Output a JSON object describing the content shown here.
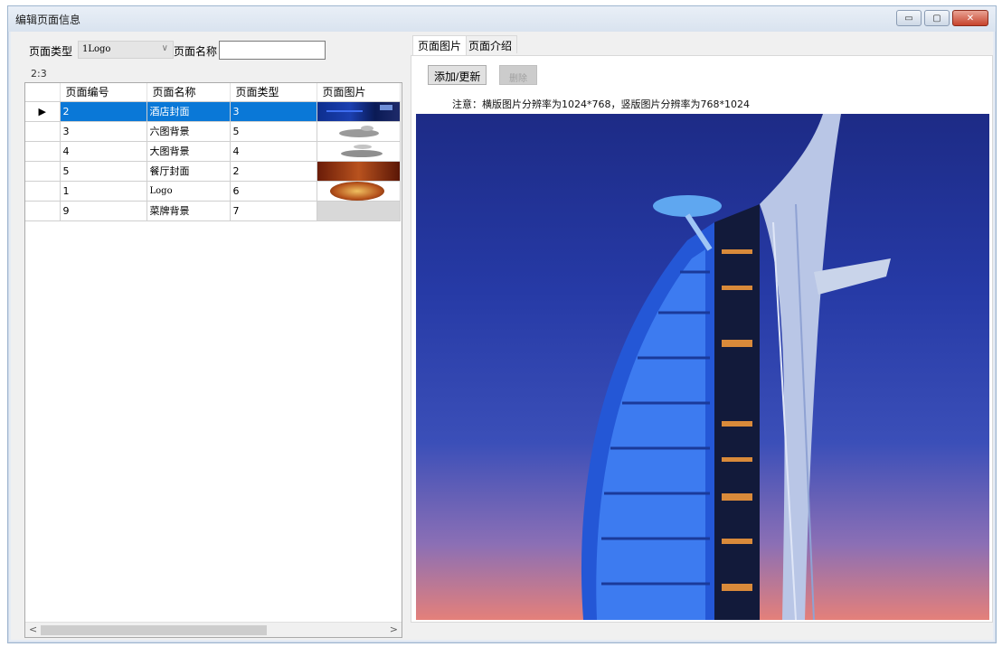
{
  "window": {
    "title": "编辑页面信息",
    "buttons": {
      "minimize": "▭",
      "maximize": "▢",
      "close": "✕"
    }
  },
  "filter": {
    "type_label": "页面类型",
    "type_value": "1Logo",
    "name_label": "页面名称",
    "name_value": ""
  },
  "ratio": "2:3",
  "grid": {
    "columns": [
      "页面编号",
      "页面名称",
      "页面类型",
      "页面图片"
    ],
    "rows": [
      {
        "id": "2",
        "name": "酒店封面",
        "type": "3",
        "thumb": "blue-night",
        "selected": true
      },
      {
        "id": "3",
        "name": "六图背景",
        "type": "5",
        "thumb": "gray-splash",
        "selected": false
      },
      {
        "id": "4",
        "name": "大图背景",
        "type": "4",
        "thumb": "gray-splash",
        "selected": false
      },
      {
        "id": "5",
        "name": "餐厅封面",
        "type": "2",
        "thumb": "restaurant",
        "selected": false
      },
      {
        "id": "1",
        "name": "Logo",
        "type": "6",
        "thumb": "logo",
        "selected": false
      },
      {
        "id": "9",
        "name": "菜牌背景",
        "type": "7",
        "thumb": "blank",
        "selected": false
      }
    ],
    "row_indicator": "▶",
    "scroll_left": "<",
    "scroll_right": ">"
  },
  "tabs": [
    {
      "label": "页面图片",
      "active": true
    },
    {
      "label": "页面介绍",
      "active": false
    }
  ],
  "image_page": {
    "add_button": "添加/更新",
    "delete_button": "删除",
    "note": "注意：横版图片分辨率为1024*768，竖版图片分辨率为768*1024"
  },
  "colors": {
    "selection": "#0a78d7",
    "window_frame": "#9fb6cf"
  }
}
